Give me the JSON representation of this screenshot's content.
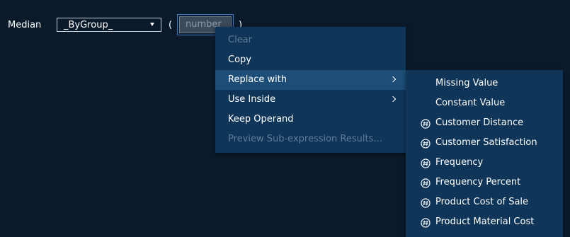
{
  "expression": {
    "function_label": "Median",
    "group_select": {
      "value": "_ByGroup_",
      "icon": "chevron-down-icon"
    },
    "open_paren": "(",
    "close_paren": ")",
    "operand_placeholder": "number"
  },
  "context_menu": {
    "items": [
      {
        "label": "Clear",
        "enabled": false
      },
      {
        "label": "Copy",
        "enabled": true
      },
      {
        "label": "Replace with",
        "enabled": true,
        "has_submenu": true,
        "highlighted": true
      },
      {
        "label": "Use Inside",
        "enabled": true,
        "has_submenu": true
      },
      {
        "label": "Keep Operand",
        "enabled": true
      },
      {
        "label": "Preview Sub-expression Results...",
        "enabled": false
      }
    ]
  },
  "submenu": {
    "items": [
      {
        "label": "Missing Value",
        "icon": null
      },
      {
        "label": "Constant Value",
        "icon": null
      },
      {
        "label": "Customer Distance",
        "icon": "numeric-variable-icon"
      },
      {
        "label": "Customer Satisfaction",
        "icon": "numeric-variable-icon"
      },
      {
        "label": "Frequency",
        "icon": "numeric-variable-icon"
      },
      {
        "label": "Frequency Percent",
        "icon": "numeric-variable-icon"
      },
      {
        "label": "Product Cost of Sale",
        "icon": "numeric-variable-icon"
      },
      {
        "label": "Product Material Cost",
        "icon": "numeric-variable-icon"
      }
    ]
  },
  "colors": {
    "background": "#0b1a2b",
    "menu_background": "#0f3658",
    "menu_highlight": "#1d4e78",
    "disabled_text": "#5f7b95",
    "focus_border": "#3b78c6"
  }
}
